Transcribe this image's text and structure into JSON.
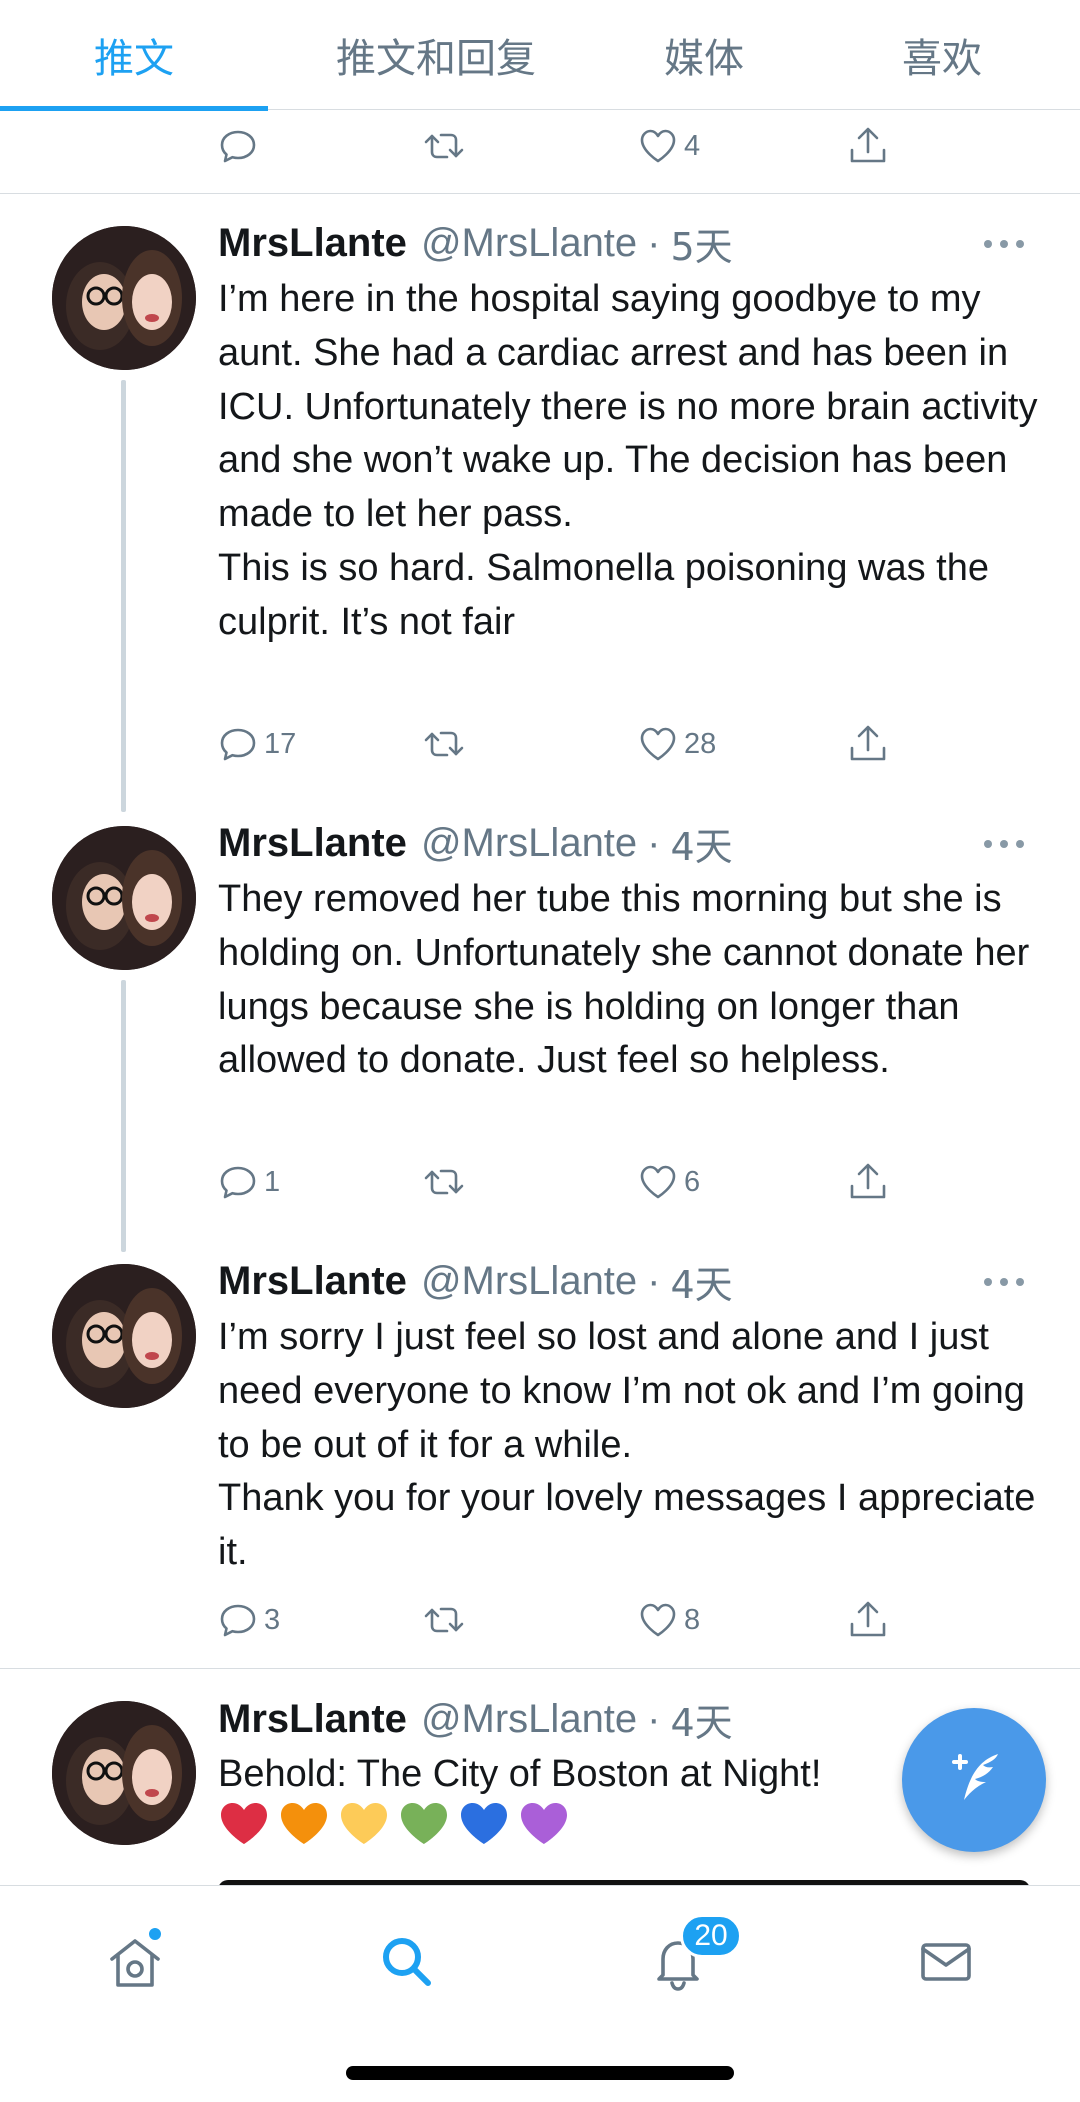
{
  "tabs": [
    {
      "label": "推文",
      "active": true
    },
    {
      "label": "推文和回复",
      "active": false
    },
    {
      "label": "媒体",
      "active": false
    },
    {
      "label": "喜欢",
      "active": false
    }
  ],
  "top_partial_tweet": {
    "actions": {
      "replies": "",
      "retweets": "",
      "likes": "4"
    }
  },
  "tweets": [
    {
      "name": "MrsLlante",
      "handle": "@MrsLlante",
      "separator": "·",
      "time": "5天",
      "text": "I’m here in the hospital saying goodbye to my aunt. She had a cardiac arrest and has been in ICU. Unfortunately there is no more brain activity and she won’t wake up. The decision has been made to let her pass.\nThis is so hard. Salmonella poisoning was the culprit. It’s not fair",
      "replies": "17",
      "retweets": "",
      "likes": "28"
    },
    {
      "name": "MrsLlante",
      "handle": "@MrsLlante",
      "separator": "·",
      "time": "4天",
      "text": "They removed her tube this morning but she is holding on. Unfortunately she cannot donate her lungs because she is holding on longer than allowed to donate. Just feel so helpless.",
      "replies": "1",
      "retweets": "",
      "likes": "6"
    },
    {
      "name": "MrsLlante",
      "handle": "@MrsLlante",
      "separator": "·",
      "time": "4天",
      "text": "I’m sorry I just feel so lost and alone and I just need everyone to know I’m not ok and I’m going to be out of it for a while.\nThank you for your lovely messages I appreciate it.",
      "replies": "3",
      "retweets": "",
      "likes": "8"
    },
    {
      "name": "MrsLlante",
      "handle": "@MrsLlante",
      "separator": "·",
      "time": "4天",
      "text": "Behold: The City of Boston at Night!",
      "emoji_hearts": [
        "#dd2e44",
        "#f4900c",
        "#fdcb58",
        "#78b159",
        "#2b6fe0",
        "#aa5fd8"
      ]
    }
  ],
  "bottom_nav": {
    "notification_count": "20",
    "active": "search"
  },
  "colors": {
    "accent": "#1da1f2",
    "fab": "#4a99e9",
    "muted": "#657786"
  },
  "icons": {
    "reply": "reply-icon",
    "retweet": "retweet-icon",
    "like": "like-icon",
    "share": "share-icon",
    "more": "more-icon",
    "compose": "compose-tweet-icon"
  }
}
